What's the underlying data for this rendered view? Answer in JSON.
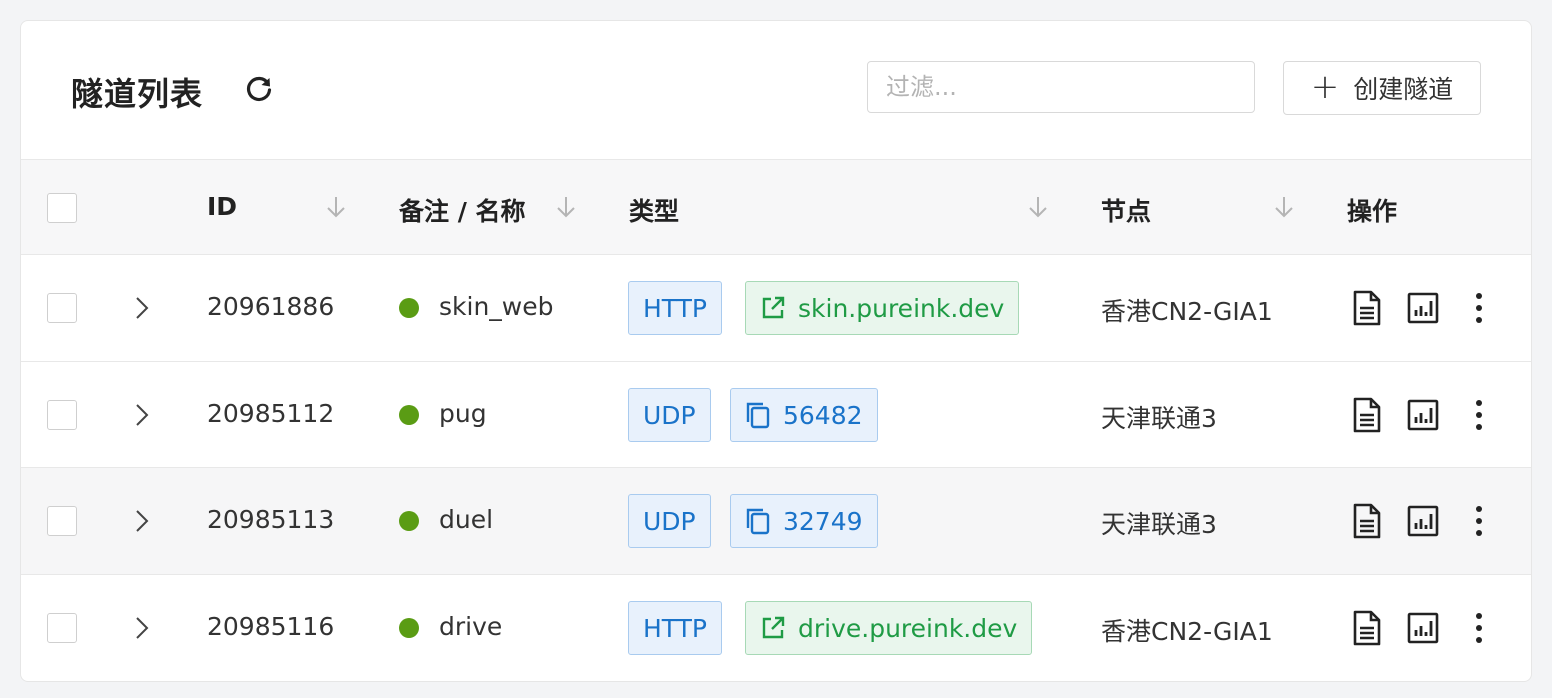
{
  "header": {
    "title": "隧道列表",
    "filter_placeholder": "过滤...",
    "create_label": "创建隧道"
  },
  "table": {
    "columns": {
      "id": "ID",
      "name": "备注 / 名称",
      "type": "类型",
      "node": "节点",
      "actions": "操作"
    },
    "rows": [
      {
        "id": "20961886",
        "name": "skin_web",
        "type": "HTTP",
        "endpoint": "skin.pureink.dev",
        "endpoint_kind": "link",
        "node": "香港CN2-GIA1",
        "status": "online"
      },
      {
        "id": "20985112",
        "name": "pug",
        "type": "UDP",
        "endpoint": "56482",
        "endpoint_kind": "port",
        "node": "天津联通3",
        "status": "online"
      },
      {
        "id": "20985113",
        "name": "duel",
        "type": "UDP",
        "endpoint": "32749",
        "endpoint_kind": "port",
        "node": "天津联通3",
        "status": "online"
      },
      {
        "id": "20985116",
        "name": "drive",
        "type": "HTTP",
        "endpoint": "drive.pureink.dev",
        "endpoint_kind": "link",
        "node": "香港CN2-GIA1",
        "status": "online"
      }
    ]
  },
  "icons": {
    "refresh": "refresh-icon",
    "sort": "sort-arrow-icon",
    "expand": "chevron-right-icon",
    "link": "external-link-icon",
    "copy": "copy-icon",
    "log": "document-icon",
    "stats": "chart-icon",
    "more": "more-vertical-icon"
  },
  "colors": {
    "status_online": "#5a9c14",
    "type_tag": "#1a73c9",
    "link_tag": "#1f9b45"
  }
}
